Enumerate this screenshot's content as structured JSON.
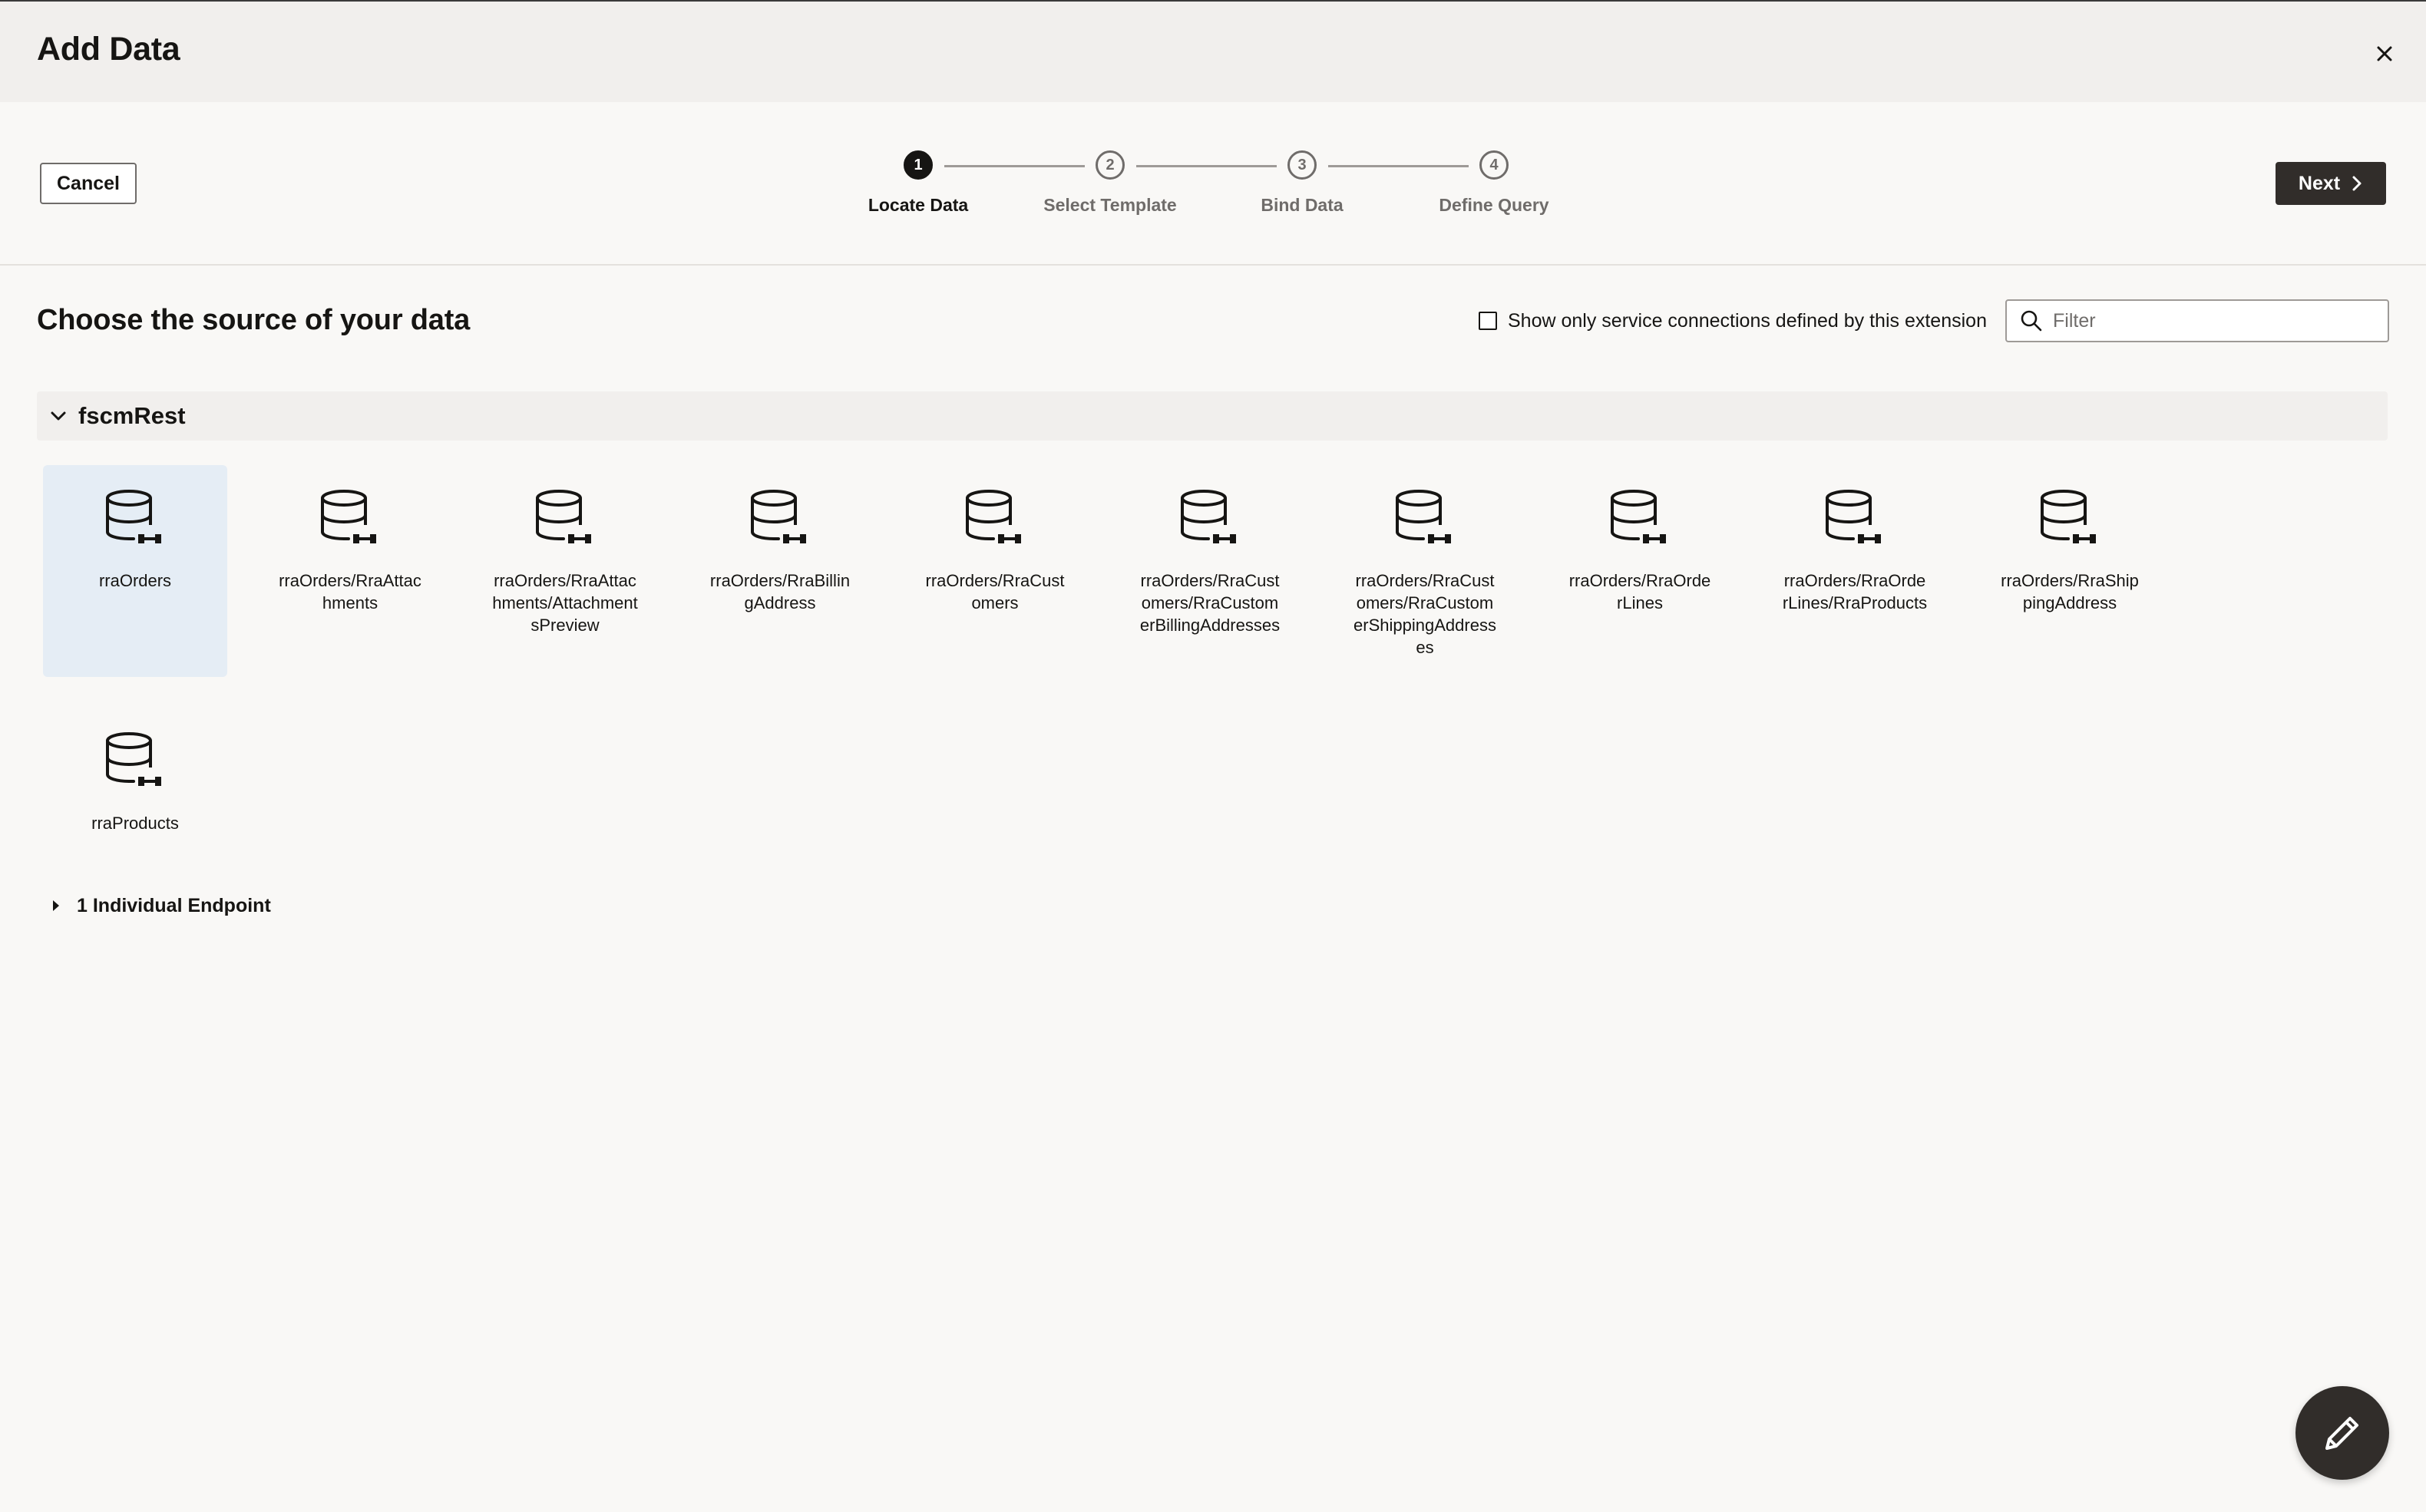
{
  "dialog": {
    "title": "Add Data"
  },
  "toolbar": {
    "cancel_label": "Cancel",
    "next_label": "Next"
  },
  "steps": [
    {
      "number": "1",
      "label": "Locate Data"
    },
    {
      "number": "2",
      "label": "Select Template"
    },
    {
      "number": "3",
      "label": "Bind Data"
    },
    {
      "number": "4",
      "label": "Define Query"
    }
  ],
  "main": {
    "heading": "Choose the source of your data",
    "service_filter_label": "Show only service connections defined by this extension",
    "filter_placeholder": "Filter"
  },
  "group": {
    "name": "fscmRest",
    "endpoints": [
      {
        "label": "rraOrders",
        "selected": true
      },
      {
        "label": "rraOrders/RraAttachments"
      },
      {
        "label": "rraOrders/RraAttachments/AttachmentsPreview"
      },
      {
        "label": "rraOrders/RraBillingAddress"
      },
      {
        "label": "rraOrders/RraCustomers"
      },
      {
        "label": "rraOrders/RraCustomers/RraCustomerBillingAddresses"
      },
      {
        "label": "rraOrders/RraCustomers/RraCustomerShippingAddresses"
      },
      {
        "label": "rraOrders/RraOrderLines"
      },
      {
        "label": "rraOrders/RraOrderLines/RraProducts"
      },
      {
        "label": "rraOrders/RraShippingAddress"
      },
      {
        "label": "rraProducts"
      }
    ]
  },
  "individual_endpoint": {
    "label": "1 Individual Endpoint"
  },
  "icons": {
    "close": "close-icon",
    "next": "chevron-right-icon",
    "search": "search-icon",
    "group_toggle": "chevron-down-icon",
    "endpoint": "database-icon",
    "expand": "caret-right-icon",
    "fab": "pencil-icon"
  },
  "colors": {
    "selected_tile": "#e5edf5",
    "primary_button": "#312d2a"
  }
}
